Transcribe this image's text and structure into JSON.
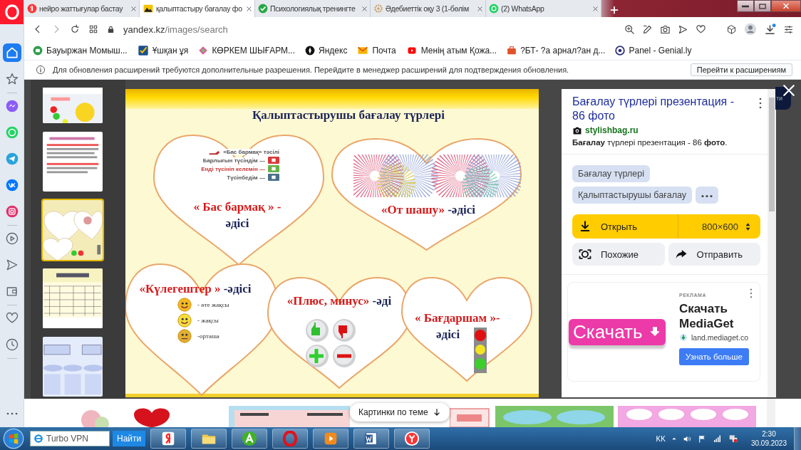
{
  "tabs": [
    {
      "title": "нейро жаттығулар бастау",
      "selected": false
    },
    {
      "title": "қалыптастыру бағалау фо",
      "selected": true
    },
    {
      "title": "Психологиялық тренингте",
      "selected": false
    },
    {
      "title": "Әдебиеттік оқу 3 (1-бөлім",
      "selected": false
    },
    {
      "title": "(2) WhatsApp",
      "selected": false
    }
  ],
  "address_bar": {
    "host": "yandex.kz",
    "path": "/images/search"
  },
  "bookmarks": [
    {
      "label": "Бауыржан Момыш..."
    },
    {
      "label": "Ұшқан ұя"
    },
    {
      "label": "КӨРКЕМ ШЫҒАРМ..."
    },
    {
      "label": "Яндекс"
    },
    {
      "label": "Почта"
    },
    {
      "label": "Менің атым Қожа..."
    },
    {
      "label": "?БТ- ?а арнал?ан д..."
    },
    {
      "label": "Panel - Genial.ly"
    }
  ],
  "info_bar": {
    "message": "Для обновления расширений требуются дополнительные разрешения. Перейдите в менеджер расширений для подтверждения обновления.",
    "button": "Перейти к расширениям"
  },
  "sidebar": {
    "items": [
      {
        "selected": true
      },
      {
        "selected": false
      },
      {
        "selected": false
      },
      {
        "selected": false
      },
      {
        "selected": false
      },
      {
        "selected": false
      },
      {
        "selected": false
      },
      {
        "selected": false
      },
      {
        "selected": false
      },
      {
        "selected": false
      },
      {
        "selected": false
      },
      {
        "selected": false
      }
    ]
  },
  "viewer": {
    "thumbnails": [
      {
        "kind": "picture",
        "selected": false
      },
      {
        "kind": "picture",
        "selected": false
      },
      {
        "kind": "picture",
        "selected": true
      },
      {
        "kind": "picture",
        "selected": false
      },
      {
        "kind": "picture",
        "selected": false
      }
    ],
    "slide": {
      "title": "Қалыптастырушы бағалау түрлері",
      "methods": [
        {
          "name": "« Бас бармақ » -",
          "suffix": "әдісі"
        },
        {
          "name": "«От шашу»",
          "suffix": "-әдісі"
        },
        {
          "name": "«Күлегештер »",
          "suffix": "-әдісі"
        },
        {
          "name": "«Плюс, минус»",
          "suffix": "-әді"
        },
        {
          "name": "« Бағдаршам »-",
          "suffix": "әдісі"
        }
      ],
      "thumb_scale": {
        "title": "«Бас бармақ» тәсілі",
        "rows": [
          "Барлығын түсіндім —",
          "Енді түсініп келемін —",
          "Түсінбедім —"
        ]
      },
      "smiley_scale": [
        "- өте жақсы",
        "- жақсы",
        "-орташа"
      ]
    },
    "details": {
      "title": "Бағалау түрлері презентация - 86 фото",
      "source": "stylishbag.ru",
      "description": "**Бағалау** түрлері презентация - 86 **фото**.",
      "tags": [
        "Бағалау түрлері",
        "Қалыптастырушы бағалау"
      ],
      "open_button": "Открыть",
      "size": "800×600",
      "similar_button": "Похожие",
      "share_button": "Отправить"
    },
    "ad": {
      "label": "РЕКЛАМА",
      "image_text": "Скачать",
      "title": "Скачать MediaGet",
      "domain": "land.mediaget.co",
      "button": "Узнать больше"
    },
    "background_button": "ти"
  },
  "related": {
    "button": "Картинки по теме"
  },
  "taskbar": {
    "search": "Turbo VPN",
    "search_button": "Найти",
    "language": "KK",
    "time": "2:30",
    "date": "30.09.2023"
  }
}
